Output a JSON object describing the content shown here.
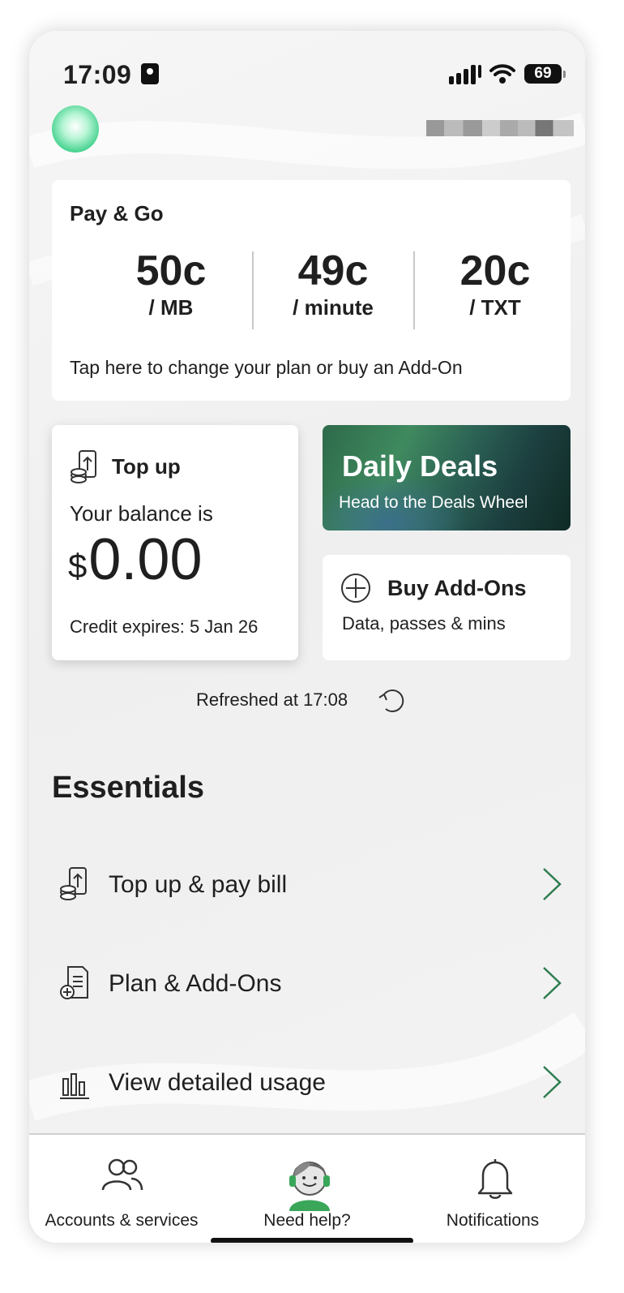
{
  "status_bar": {
    "time": "17:09",
    "battery": "69"
  },
  "plan_card": {
    "title": "Pay & Go",
    "rates": [
      {
        "value": "50c",
        "unit": "/ MB"
      },
      {
        "value": "49c",
        "unit": "/ minute"
      },
      {
        "value": "20c",
        "unit": "/ TXT"
      }
    ],
    "cta": "Tap here to change your plan or buy an Add-On"
  },
  "topup_card": {
    "title": "Top up",
    "balance_label": "Your balance is",
    "currency": "$",
    "balance": "0.00",
    "expiry": "Credit expires: 5 Jan 26"
  },
  "deals_card": {
    "title": "Daily Deals",
    "subtitle": "Head to the Deals Wheel"
  },
  "addons_card": {
    "title": "Buy Add-Ons",
    "subtitle": "Data, passes & mins"
  },
  "refresh": {
    "text": "Refreshed at 17:08"
  },
  "essentials": {
    "heading": "Essentials",
    "items": [
      {
        "label": "Top up & pay bill",
        "icon": "topup-icon"
      },
      {
        "label": "Plan & Add-Ons",
        "icon": "plan-document-icon"
      },
      {
        "label": "View detailed usage",
        "icon": "bar-chart-icon"
      }
    ]
  },
  "tabs": [
    {
      "label": "Accounts & services",
      "icon": "people-icon"
    },
    {
      "label": "Need help?",
      "icon": "support-agent-icon"
    },
    {
      "label": "Notifications",
      "icon": "bell-icon"
    }
  ],
  "colors": {
    "accent": "#2e8b57",
    "chevron": "#2f7d4f",
    "avatar": "#3fd08a"
  }
}
